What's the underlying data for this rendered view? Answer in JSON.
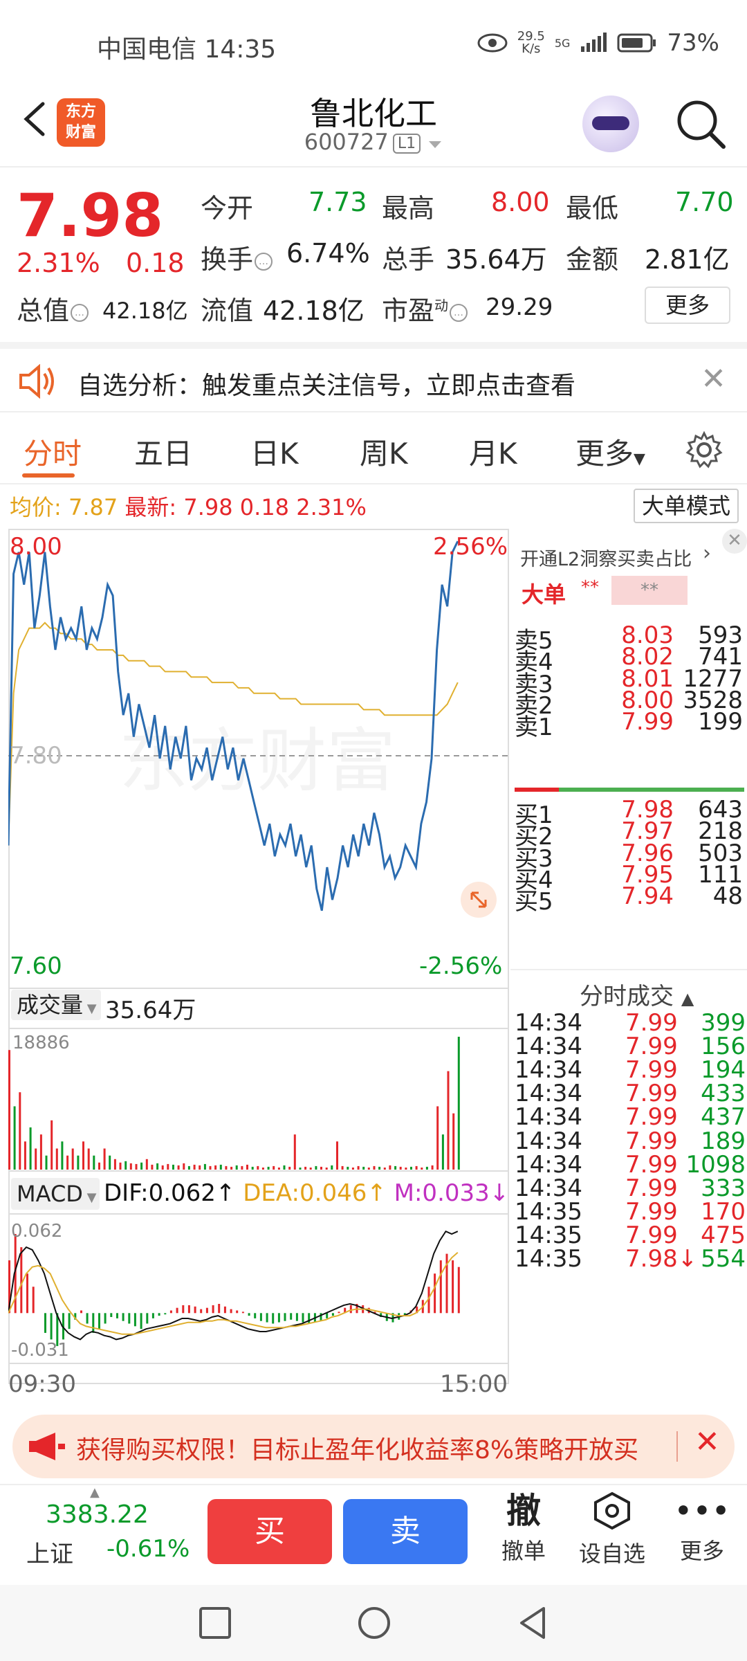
{
  "status_bar": {
    "carrier_time": "中国电信 14:35",
    "net_speed_top": "29.5",
    "net_speed_unit": "K/s",
    "signal": "5G",
    "battery": "73%"
  },
  "header": {
    "title": "鲁北化工",
    "code": "600727",
    "level_tag": "L1",
    "logo_text_1": "东方",
    "logo_text_2": "财富"
  },
  "quote": {
    "price": "7.98",
    "change_pct": "2.31%",
    "change": "0.18",
    "open_label": "今开",
    "open": "7.73",
    "high_label": "最高",
    "high": "8.00",
    "low_label": "最低",
    "low": "7.70",
    "turnover_label": "换手",
    "turnover": "6.74%",
    "volume_label": "总手",
    "volume": "35.64万",
    "amount_label": "金额",
    "amount": "2.81亿",
    "mktcap_label": "总值",
    "mktcap": "42.18亿",
    "float_label": "流值",
    "float": "42.18亿",
    "pe_label": "市盈",
    "pe_sup": "动",
    "pe": "29.29",
    "more": "更多"
  },
  "banner": {
    "text": "自选分析：触发重点关注信号，立即点击查看"
  },
  "tabs": [
    "分时",
    "五日",
    "日K",
    "周K",
    "月K",
    "更多"
  ],
  "active_tab": 0,
  "legend": {
    "avg_label": "均价:",
    "avg": "7.87",
    "latest_label": "最新:",
    "latest": "7.98",
    "change": "0.18",
    "pct": "2.31%",
    "big_mode": "大单模式"
  },
  "chart_data": {
    "type": "line",
    "price_high_label": "8.00",
    "price_low_label": "7.60",
    "pct_high_label": "2.56%",
    "pct_low_label": "-2.56%",
    "mid_label": "7.80",
    "ylim": [
      7.6,
      8.0
    ],
    "x_start": "09:30",
    "x_end": "15:00",
    "series": [
      {
        "kind": "price",
        "color": "#2b6cb0",
        "values": [
          7.72,
          7.97,
          7.99,
          7.96,
          7.99,
          7.92,
          7.95,
          7.99,
          7.94,
          7.9,
          7.93,
          7.91,
          7.92,
          7.91,
          7.94,
          7.9,
          7.92,
          7.91,
          7.93,
          7.96,
          7.95,
          7.88,
          7.84,
          7.86,
          7.82,
          7.85,
          7.83,
          7.81,
          7.84,
          7.8,
          7.83,
          7.79,
          7.82,
          7.8,
          7.83,
          7.78,
          7.8,
          7.79,
          7.81,
          7.78,
          7.8,
          7.82,
          7.79,
          7.81,
          7.78,
          7.8,
          7.78,
          7.76,
          7.74,
          7.72,
          7.74,
          7.71,
          7.73,
          7.72,
          7.74,
          7.71,
          7.73,
          7.7,
          7.72,
          7.68,
          7.66,
          7.7,
          7.67,
          7.69,
          7.72,
          7.7,
          7.73,
          7.71,
          7.74,
          7.72,
          7.75,
          7.73,
          7.7,
          7.71,
          7.69,
          7.7,
          7.72,
          7.71,
          7.7,
          7.74,
          7.76,
          7.8,
          7.9,
          7.96,
          7.94,
          7.99,
          8.0
        ]
      },
      {
        "kind": "average",
        "color": "#e0b030",
        "values": [
          7.72,
          7.86,
          7.9,
          7.91,
          7.92,
          7.92,
          7.92,
          7.925,
          7.92,
          7.92,
          7.915,
          7.915,
          7.91,
          7.91,
          7.91,
          7.905,
          7.905,
          7.9,
          7.9,
          7.9,
          7.9,
          7.895,
          7.895,
          7.89,
          7.89,
          7.89,
          7.89,
          7.885,
          7.885,
          7.885,
          7.88,
          7.88,
          7.88,
          7.88,
          7.88,
          7.875,
          7.875,
          7.875,
          7.875,
          7.87,
          7.87,
          7.87,
          7.87,
          7.87,
          7.865,
          7.865,
          7.865,
          7.86,
          7.86,
          7.86,
          7.86,
          7.86,
          7.855,
          7.855,
          7.855,
          7.855,
          7.85,
          7.85,
          7.85,
          7.85,
          7.85,
          7.85,
          7.85,
          7.85,
          7.85,
          7.85,
          7.85,
          7.85,
          7.845,
          7.845,
          7.845,
          7.845,
          7.84,
          7.84,
          7.84,
          7.84,
          7.84,
          7.84,
          7.84,
          7.84,
          7.84,
          7.84,
          7.84,
          7.845,
          7.85,
          7.86,
          7.87
        ]
      }
    ],
    "volume": {
      "label": "成交量",
      "total": "35.64万",
      "max_label": "18886",
      "values": [
        17000,
        9000,
        11000,
        4000,
        6000,
        3000,
        5000,
        2000,
        7000,
        3000,
        4000,
        2000,
        3000,
        2000,
        4000,
        3000,
        2000,
        1000,
        3000,
        2000,
        1500,
        1000,
        1200,
        900,
        800,
        1000,
        1500,
        700,
        900,
        600,
        800,
        700,
        600,
        900,
        500,
        700,
        600,
        800,
        500,
        600,
        700,
        500,
        400,
        600,
        500,
        700,
        400,
        500,
        300,
        400,
        500,
        300,
        600,
        400,
        5000,
        300,
        400,
        300,
        500,
        400,
        300,
        600,
        4000,
        500,
        400,
        300,
        500,
        400,
        300,
        500,
        400,
        300,
        600,
        500,
        400,
        300,
        400,
        500,
        300,
        400,
        600,
        9000,
        5000,
        14000,
        8000,
        18886
      ]
    },
    "macd": {
      "label": "MACD",
      "dif": "DIF:0.062↑",
      "dea": "DEA:0.046↑",
      "m": "M:0.033↓",
      "max_label": "0.062",
      "min_label": "-0.031",
      "hist": [
        0.04,
        0.06,
        0.05,
        0.03,
        0.02,
        0.0,
        -0.015,
        -0.02,
        -0.025,
        -0.02,
        -0.012,
        -0.005,
        0.002,
        -0.008,
        -0.015,
        -0.012,
        -0.008,
        -0.003,
        -0.004,
        -0.006,
        -0.008,
        -0.01,
        -0.012,
        -0.008,
        -0.004,
        -0.002,
        -0.001,
        0.002,
        0.004,
        0.006,
        0.006,
        0.005,
        0.003,
        0.004,
        0.006,
        0.007,
        0.005,
        0.003,
        0.002,
        0.001,
        -0.002,
        -0.004,
        -0.006,
        -0.007,
        -0.008,
        -0.007,
        -0.006,
        -0.005,
        -0.006,
        -0.007,
        -0.008,
        -0.007,
        -0.006,
        -0.004,
        -0.002,
        0.001,
        0.004,
        0.006,
        0.007,
        0.006,
        0.004,
        0.001,
        -0.003,
        -0.006,
        -0.007,
        -0.005,
        -0.002,
        0.002,
        0.005,
        0.01,
        0.02,
        0.03,
        0.04,
        0.045,
        0.04,
        0.035
      ],
      "dif_line": [
        0.0,
        0.03,
        0.045,
        0.05,
        0.048,
        0.04,
        0.03,
        0.015,
        0.0,
        -0.01,
        -0.015,
        -0.018,
        -0.02,
        -0.016,
        -0.014,
        -0.015,
        -0.017,
        -0.018,
        -0.02,
        -0.019,
        -0.017,
        -0.016,
        -0.014,
        -0.012,
        -0.011,
        -0.01,
        -0.009,
        -0.008,
        -0.006,
        -0.004,
        -0.004,
        -0.005,
        -0.006,
        -0.005,
        -0.003,
        -0.002,
        -0.004,
        -0.006,
        -0.008,
        -0.01,
        -0.012,
        -0.013,
        -0.014,
        -0.014,
        -0.013,
        -0.012,
        -0.011,
        -0.01,
        -0.009,
        -0.008,
        -0.006,
        -0.004,
        -0.002,
        0.0,
        0.002,
        0.004,
        0.006,
        0.007,
        0.006,
        0.004,
        0.002,
        0.0,
        -0.002,
        -0.003,
        -0.004,
        -0.003,
        -0.002,
        0.0,
        0.005,
        0.015,
        0.03,
        0.045,
        0.055,
        0.062,
        0.06,
        0.062
      ],
      "dea_line": [
        0.0,
        0.01,
        0.02,
        0.03,
        0.035,
        0.036,
        0.034,
        0.03,
        0.02,
        0.01,
        0.003,
        -0.003,
        -0.008,
        -0.01,
        -0.011,
        -0.012,
        -0.013,
        -0.014,
        -0.015,
        -0.016,
        -0.016,
        -0.016,
        -0.015,
        -0.014,
        -0.013,
        -0.012,
        -0.011,
        -0.01,
        -0.009,
        -0.008,
        -0.007,
        -0.007,
        -0.007,
        -0.006,
        -0.006,
        -0.005,
        -0.005,
        -0.006,
        -0.006,
        -0.007,
        -0.008,
        -0.009,
        -0.01,
        -0.011,
        -0.011,
        -0.011,
        -0.011,
        -0.01,
        -0.01,
        -0.009,
        -0.008,
        -0.007,
        -0.006,
        -0.005,
        -0.003,
        -0.002,
        0.0,
        0.002,
        0.003,
        0.003,
        0.003,
        0.002,
        0.001,
        0.0,
        -0.001,
        -0.002,
        -0.002,
        -0.002,
        0.0,
        0.004,
        0.01,
        0.018,
        0.028,
        0.036,
        0.042,
        0.046
      ]
    }
  },
  "order_book": {
    "header": "开通L2洞察买卖占比",
    "big_order_label": "大单",
    "big_order_val_1": "**",
    "big_order_val_2": "**",
    "asks": [
      {
        "label": "卖5",
        "price": "8.03",
        "vol": "593"
      },
      {
        "label": "卖4",
        "price": "8.02",
        "vol": "741"
      },
      {
        "label": "卖3",
        "price": "8.01",
        "vol": "1277"
      },
      {
        "label": "卖2",
        "price": "8.00",
        "vol": "3528"
      },
      {
        "label": "卖1",
        "price": "7.99",
        "vol": "199"
      }
    ],
    "bids": [
      {
        "label": "买1",
        "price": "7.98",
        "vol": "643"
      },
      {
        "label": "买2",
        "price": "7.97",
        "vol": "218"
      },
      {
        "label": "买3",
        "price": "7.96",
        "vol": "503"
      },
      {
        "label": "买4",
        "price": "7.95",
        "vol": "111"
      },
      {
        "label": "买5",
        "price": "7.94",
        "vol": "48"
      }
    ],
    "trades_header": "分时成交",
    "trades": [
      {
        "time": "14:34",
        "price": "7.99",
        "vol": "399",
        "dir": "buy"
      },
      {
        "time": "14:34",
        "price": "7.99",
        "vol": "156",
        "dir": "buy"
      },
      {
        "time": "14:34",
        "price": "7.99",
        "vol": "194",
        "dir": "buy"
      },
      {
        "time": "14:34",
        "price": "7.99",
        "vol": "433",
        "dir": "buy"
      },
      {
        "time": "14:34",
        "price": "7.99",
        "vol": "437",
        "dir": "buy"
      },
      {
        "time": "14:34",
        "price": "7.99",
        "vol": "189",
        "dir": "buy"
      },
      {
        "time": "14:34",
        "price": "7.99",
        "vol": "1098",
        "dir": "buy"
      },
      {
        "time": "14:34",
        "price": "7.99",
        "vol": "333",
        "dir": "buy"
      },
      {
        "time": "14:35",
        "price": "7.99",
        "vol": "170",
        "dir": "sell"
      },
      {
        "time": "14:35",
        "price": "7.99",
        "vol": "475",
        "dir": "sell"
      },
      {
        "time": "14:35",
        "price": "7.98↓",
        "vol": "554",
        "dir": "buy"
      }
    ]
  },
  "promo": {
    "text": "获得购买权限！目标止盈年化收益率8%策略开放买"
  },
  "bottom": {
    "index_value": "3383.22",
    "index_name": "上证",
    "index_pct": "-0.61%",
    "buy": "买",
    "sell": "卖",
    "cancel_icon_text": "撤",
    "cancel": "撤单",
    "watch": "设自选",
    "more": "更多"
  },
  "colors": {
    "up": "#e4262a",
    "down": "#0a9a2a",
    "accent": "#e9652a",
    "avg_line": "#e0b030",
    "price_line": "#2b6cb0"
  }
}
